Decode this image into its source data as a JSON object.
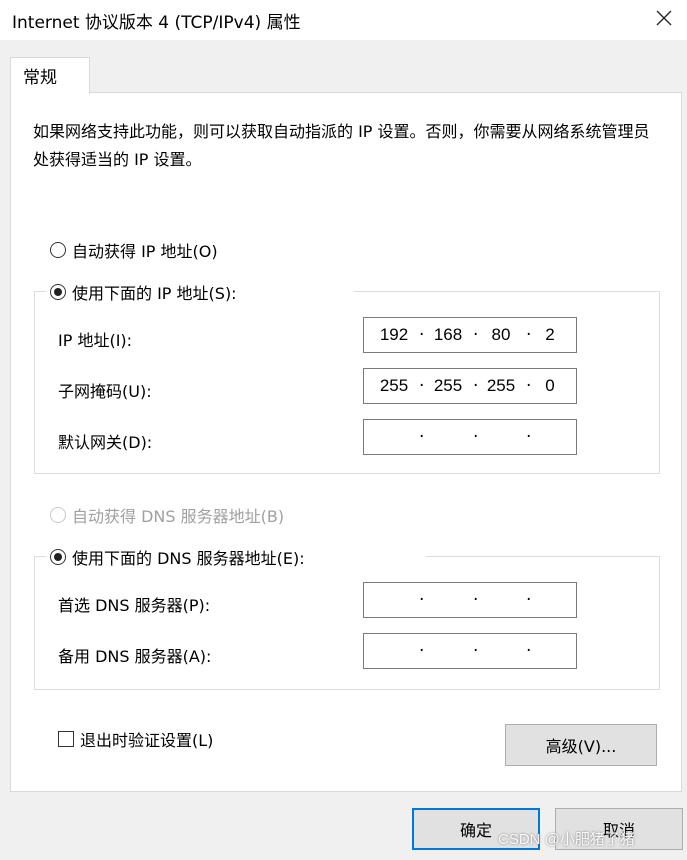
{
  "window": {
    "title": "Internet 协议版本 4 (TCP/IPv4) 属性"
  },
  "tabs": [
    {
      "label": "常规"
    }
  ],
  "description": "如果网络支持此功能，则可以获取自动指派的 IP 设置。否则，你需要从网络系统管理员处获得适当的 IP 设置。",
  "ip_section": {
    "auto_label": "自动获得 IP 地址(O)",
    "manual_label": "使用下面的 IP 地址(S):",
    "selected": "manual",
    "fields": [
      {
        "label": "IP 地址(I):",
        "octets": [
          "192",
          "168",
          "80",
          "2"
        ]
      },
      {
        "label": "子网掩码(U):",
        "octets": [
          "255",
          "255",
          "255",
          "0"
        ]
      },
      {
        "label": "默认网关(D):",
        "octets": [
          "",
          "",
          "",
          ""
        ]
      }
    ]
  },
  "dns_section": {
    "auto_label": "自动获得 DNS 服务器地址(B)",
    "manual_label": "使用下面的 DNS 服务器地址(E):",
    "auto_disabled": true,
    "selected": "manual",
    "fields": [
      {
        "label": "首选 DNS 服务器(P):",
        "octets": [
          "",
          "",
          "",
          ""
        ]
      },
      {
        "label": "备用 DNS 服务器(A):",
        "octets": [
          "",
          "",
          "",
          ""
        ]
      }
    ]
  },
  "validate_checkbox": {
    "label": "退出时验证设置(L)",
    "checked": false
  },
  "buttons": {
    "advanced": "高级(V)...",
    "ok": "确定",
    "cancel": "取消"
  },
  "watermark": "CSDN @小肥猪了猪",
  "colors": {
    "accent": "#0078d7",
    "disabled_text": "#a0a0a0"
  }
}
